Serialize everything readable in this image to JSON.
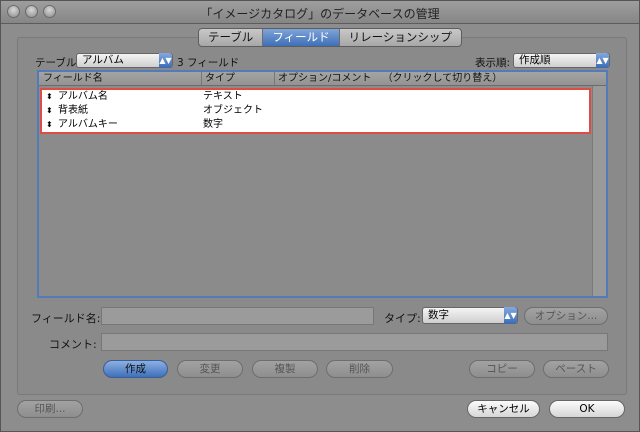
{
  "window": {
    "title": "「イメージカタログ」のデータベースの管理"
  },
  "tabs": [
    {
      "label": "テーブル",
      "active": false
    },
    {
      "label": "フィールド",
      "active": true
    },
    {
      "label": "リレーションシップ",
      "active": false
    }
  ],
  "table_selector": {
    "label": "テーブル:",
    "value": "アルバム",
    "count": "3 フィールド"
  },
  "sort_selector": {
    "label": "表示順:",
    "value": "作成順"
  },
  "columns": {
    "name": "フィールド名",
    "type": "タイプ",
    "options": "オプション/コメント",
    "hint": "（クリックして切り替え）"
  },
  "fields": [
    {
      "name": "アルバム名",
      "type": "テキスト"
    },
    {
      "name": "背表紙",
      "type": "オブジェクト"
    },
    {
      "name": "アルバムキー",
      "type": "数字"
    }
  ],
  "form": {
    "field_name_label": "フィールド名:",
    "field_name_value": "",
    "type_label": "タイプ:",
    "type_value": "数字",
    "options_button": "オプション...",
    "comment_label": "コメント:",
    "comment_value": ""
  },
  "actions": {
    "create": "作成",
    "change": "変更",
    "duplicate": "複製",
    "delete": "削除",
    "copy": "コピー",
    "paste": "ペースト"
  },
  "footer": {
    "print": "印刷...",
    "cancel": "キャンセル",
    "ok": "OK"
  },
  "icons": {
    "close": "close-icon",
    "minimize": "minimize-icon",
    "zoom": "zoom-icon",
    "updown": "updown-arrows-icon",
    "row_handle": "drag-handle-icon"
  },
  "colors": {
    "accent": "#3e6fb8",
    "selection_outline": "#e04c44"
  }
}
